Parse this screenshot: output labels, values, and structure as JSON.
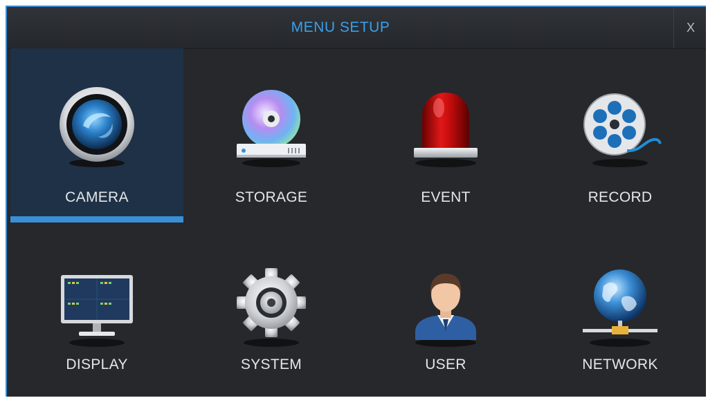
{
  "window": {
    "title": "MENU SETUP",
    "close_label": "X"
  },
  "menu": {
    "items": [
      {
        "label": "CAMERA",
        "icon": "camera-lens-icon",
        "selected": true
      },
      {
        "label": "STORAGE",
        "icon": "disc-drive-icon",
        "selected": false
      },
      {
        "label": "EVENT",
        "icon": "alarm-siren-icon",
        "selected": false
      },
      {
        "label": "RECORD",
        "icon": "film-reel-icon",
        "selected": false
      },
      {
        "label": "DISPLAY",
        "icon": "monitor-icon",
        "selected": false
      },
      {
        "label": "SYSTEM",
        "icon": "gear-icon",
        "selected": false
      },
      {
        "label": "USER",
        "icon": "user-icon",
        "selected": false
      },
      {
        "label": "NETWORK",
        "icon": "globe-network-icon",
        "selected": false
      }
    ]
  },
  "colors": {
    "accent": "#3b8fd6",
    "title": "#3aa0ea",
    "background": "#26282c",
    "selected_background": "#1f3146"
  }
}
